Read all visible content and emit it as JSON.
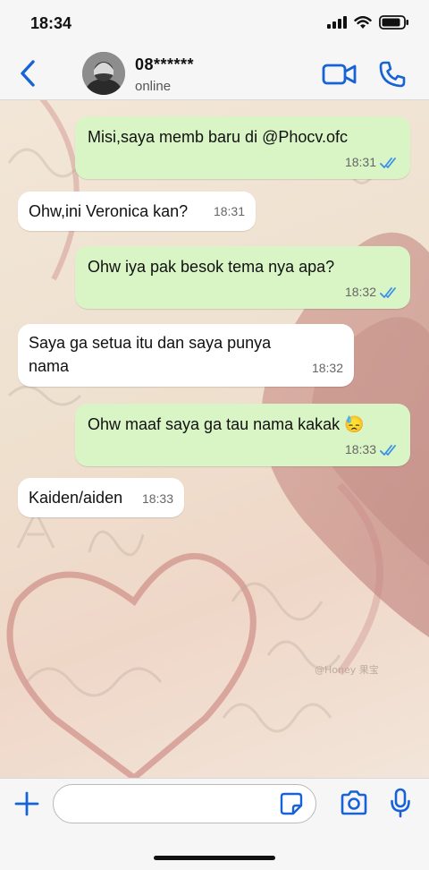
{
  "status_bar": {
    "time": "18:34",
    "icons": [
      "signal-icon",
      "wifi-icon",
      "battery-icon"
    ]
  },
  "header": {
    "back_icon": "chevron-left-icon",
    "contact_name": "08******",
    "contact_status": "online",
    "video_call_icon": "video-camera-icon",
    "voice_call_icon": "phone-icon"
  },
  "colors": {
    "accent": "#1662d6",
    "outgoing_bubble": "#d9f5c6",
    "incoming_bubble": "#ffffff",
    "read_tick": "#3a8fe8"
  },
  "messages": [
    {
      "direction": "out",
      "text": "Misi,saya memb baru di @Phocv.ofc",
      "time": "18:31",
      "status": "read"
    },
    {
      "direction": "in",
      "text": "Ohw,ini Veronica kan?",
      "time": "18:31"
    },
    {
      "direction": "out",
      "text": "Ohw iya pak besok tema nya apa?",
      "time": "18:32",
      "status": "read"
    },
    {
      "direction": "in",
      "text": "Saya ga setua itu dan saya punya nama",
      "time": "18:32"
    },
    {
      "direction": "out",
      "text": "Ohw maaf saya ga tau nama kakak 😓",
      "time": "18:33",
      "status": "read"
    },
    {
      "direction": "in",
      "text": "Kaiden/aiden",
      "time": "18:33"
    }
  ],
  "wallpaper_text": {
    "watermark": "@Honey 果宝"
  },
  "composer": {
    "value": "",
    "placeholder": "",
    "icons": [
      "plus-icon",
      "sticker-icon",
      "camera-icon",
      "microphone-icon"
    ]
  }
}
